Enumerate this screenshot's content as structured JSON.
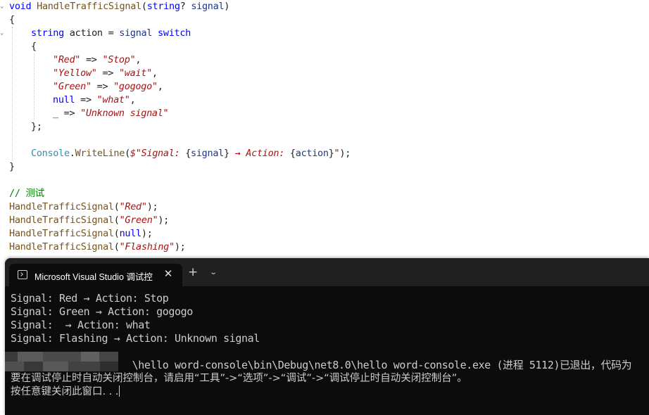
{
  "editor": {
    "code_lines": [
      {
        "segments": [
          [
            "kw",
            "void "
          ],
          [
            "fn",
            "HandleTrafficSignal"
          ],
          [
            "pl",
            "("
          ],
          [
            "kw",
            "string"
          ],
          [
            "pl",
            "? "
          ],
          [
            "pm",
            "signal"
          ],
          [
            "pl",
            ")"
          ]
        ]
      },
      {
        "segments": [
          [
            "pl",
            "{"
          ]
        ]
      },
      {
        "segments": [
          [
            "kw",
            "string "
          ],
          [
            "pl",
            "action = "
          ],
          [
            "pm",
            "signal "
          ],
          [
            "kw",
            "switch"
          ]
        ]
      },
      {
        "segments": [
          [
            "pl",
            "{"
          ]
        ]
      },
      {
        "segments": [
          [
            "str",
            "\"Red\""
          ],
          [
            "pl",
            " => "
          ],
          [
            "str",
            "\"Stop\""
          ],
          [
            "pl",
            ","
          ]
        ]
      },
      {
        "segments": [
          [
            "str",
            "\"Yellow\""
          ],
          [
            "pl",
            " => "
          ],
          [
            "str",
            "\"wait\""
          ],
          [
            "pl",
            ","
          ]
        ]
      },
      {
        "segments": [
          [
            "str",
            "\"Green\""
          ],
          [
            "pl",
            " => "
          ],
          [
            "str",
            "\"gogogo\""
          ],
          [
            "pl",
            ","
          ]
        ]
      },
      {
        "segments": [
          [
            "kw",
            "null"
          ],
          [
            "pl",
            " => "
          ],
          [
            "str",
            "\"what\""
          ],
          [
            "pl",
            ","
          ]
        ]
      },
      {
        "segments": [
          [
            "kw",
            "_"
          ],
          [
            "pl",
            " => "
          ],
          [
            "str",
            "\"Unknown signal\""
          ]
        ]
      },
      {
        "segments": [
          [
            "pl",
            "};"
          ]
        ]
      },
      {
        "segments": []
      },
      {
        "segments": [
          [
            "ty",
            "Console"
          ],
          [
            "pl",
            "."
          ],
          [
            "fn",
            "WriteLine"
          ],
          [
            "pl",
            "("
          ],
          [
            "str",
            "$\"Signal: "
          ],
          [
            "pl",
            "{"
          ],
          [
            "pm",
            "signal"
          ],
          [
            "pl",
            "} "
          ],
          [
            "arrow-red",
            "→"
          ],
          [
            "str",
            " Action: "
          ],
          [
            "pl",
            "{"
          ],
          [
            "pm",
            "action"
          ],
          [
            "pl",
            "}"
          ],
          [
            "str",
            "\""
          ],
          [
            "pl",
            ");"
          ]
        ]
      },
      {
        "segments": [
          [
            "pl",
            "}"
          ]
        ]
      },
      {
        "segments": []
      },
      {
        "segments": [
          [
            "cm",
            "// 测试"
          ]
        ]
      },
      {
        "segments": [
          [
            "fn",
            "HandleTrafficSignal"
          ],
          [
            "pl",
            "("
          ],
          [
            "str",
            "\"Red\""
          ],
          [
            "pl",
            ");"
          ]
        ]
      },
      {
        "segments": [
          [
            "fn",
            "HandleTrafficSignal"
          ],
          [
            "pl",
            "("
          ],
          [
            "str",
            "\"Green\""
          ],
          [
            "pl",
            ");"
          ]
        ]
      },
      {
        "segments": [
          [
            "fn",
            "HandleTrafficSignal"
          ],
          [
            "pl",
            "("
          ],
          [
            "kw",
            "null"
          ],
          [
            "pl",
            ");"
          ]
        ]
      },
      {
        "segments": [
          [
            "fn",
            "HandleTrafficSignal"
          ],
          [
            "pl",
            "("
          ],
          [
            "str",
            "\"Flashing\""
          ],
          [
            "pl",
            ");"
          ]
        ]
      }
    ]
  },
  "terminal": {
    "tab_title": "Microsoft Visual Studio 调试控",
    "tab_close": "✕",
    "new_tab": "+",
    "dropdown": "⌄",
    "output_lines": [
      "Signal: Red → Action: Stop",
      "Signal: Green → Action: gogogo",
      "Signal:  → Action: what",
      "Signal: Flashing → Action: Unknown signal",
      "",
      "                    \\hello word-console\\bin\\Debug\\net8.0\\hello word-console.exe (进程 5112)已退出，代码为",
      "要在调试停止时自动关闭控制台，请启用“工具”->“选项”->“调试”->“调试停止时自动关闭控制台”。",
      "按任意键关闭此窗口. . ."
    ]
  },
  "colors": {
    "keyword": "#0000ff",
    "type": "#2b91af",
    "method": "#74531f",
    "string": "#a31515",
    "comment": "#008000",
    "terminal_bg": "#0c0c0c",
    "terminal_text": "#cccccc"
  },
  "icons": {
    "tab_icon": "console-window-icon"
  }
}
